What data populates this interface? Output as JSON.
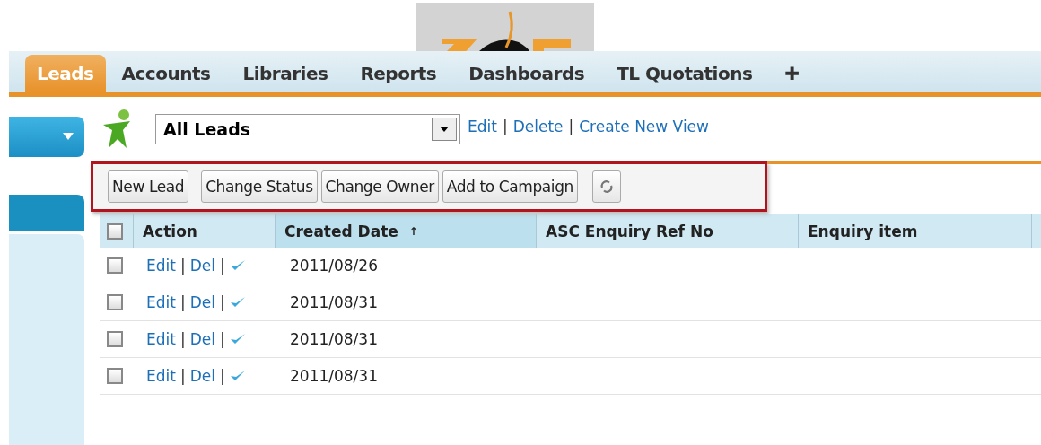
{
  "tabs": [
    {
      "label": "Leads",
      "selected": true
    },
    {
      "label": "Accounts",
      "selected": false
    },
    {
      "label": "Libraries",
      "selected": false
    },
    {
      "label": "Reports",
      "selected": false
    },
    {
      "label": "Dashboards",
      "selected": false
    },
    {
      "label": "TL Quotations",
      "selected": false
    },
    {
      "label": "✚",
      "selected": false
    }
  ],
  "view": {
    "value": "All Leads",
    "links": [
      {
        "kind": "link",
        "text": "Edit"
      },
      {
        "kind": "separator",
        "text": "|"
      },
      {
        "kind": "link",
        "text": "Delete"
      },
      {
        "kind": "separator",
        "text": "|"
      },
      {
        "kind": "link",
        "text": "Create New View"
      }
    ]
  },
  "toolbar": {
    "buttons": [
      "New Lead",
      "Change Status",
      "Change Owner",
      "Add to Campaign"
    ]
  },
  "table": {
    "select_all_checked": false,
    "columns": [
      {
        "label": "Action"
      },
      {
        "label": "Created Date",
        "sort": "↑"
      },
      {
        "label": "ASC Enquiry Ref No"
      },
      {
        "label": "Enquiry item"
      }
    ],
    "rows": [
      {
        "checked": false,
        "actions": [
          {
            "kind": "link",
            "text": "Edit"
          },
          {
            "kind": "separator",
            "text": "|"
          },
          {
            "kind": "link",
            "text": "Del"
          },
          {
            "kind": "separator",
            "text": "|"
          }
        ],
        "created_date": "2011/08/26"
      },
      {
        "checked": false,
        "actions": [
          {
            "kind": "link",
            "text": "Edit"
          },
          {
            "kind": "separator",
            "text": "|"
          },
          {
            "kind": "link",
            "text": "Del"
          },
          {
            "kind": "separator",
            "text": "|"
          }
        ],
        "created_date": "2011/08/31"
      },
      {
        "checked": false,
        "actions": [
          {
            "kind": "link",
            "text": "Edit"
          },
          {
            "kind": "separator",
            "text": "|"
          },
          {
            "kind": "link",
            "text": "Del"
          },
          {
            "kind": "separator",
            "text": "|"
          }
        ],
        "created_date": "2011/08/31"
      },
      {
        "checked": false,
        "actions": [
          {
            "kind": "link",
            "text": "Edit"
          },
          {
            "kind": "separator",
            "text": "|"
          },
          {
            "kind": "link",
            "text": "Del"
          },
          {
            "kind": "separator",
            "text": "|"
          }
        ],
        "created_date": "2011/08/31"
      }
    ]
  }
}
